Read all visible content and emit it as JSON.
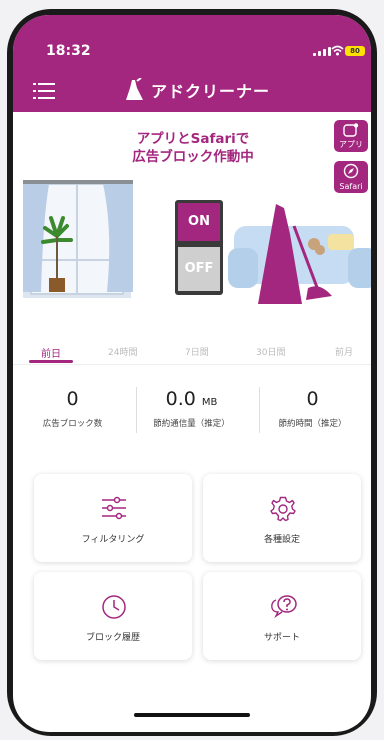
{
  "status_bar": {
    "time": "18:32",
    "battery": "80"
  },
  "navbar": {
    "app_name": "アドクリーナー"
  },
  "hero": {
    "headline_line1": "アプリとSafariで",
    "headline_line2": "広告ブロック作動中",
    "app_button_label": "アプリ",
    "safari_button_label": "Safari",
    "switch_on": "ON",
    "switch_off": "OFF"
  },
  "tabs": [
    "前日",
    "24時間",
    "7日間",
    "30日間",
    "前月"
  ],
  "active_tab": "前日",
  "stats": [
    {
      "value": "0",
      "unit": "",
      "label": "広告ブロック数"
    },
    {
      "value": "0.0",
      "unit": "MB",
      "label": "節約通信量（推定）"
    },
    {
      "value": "0",
      "unit": "",
      "label": "節約時間（推定）"
    }
  ],
  "cards": [
    {
      "label": "フィルタリング",
      "icon": "sliders-icon"
    },
    {
      "label": "各種設定",
      "icon": "gear-icon"
    },
    {
      "label": "ブロック履歴",
      "icon": "clock-icon"
    },
    {
      "label": "サポート",
      "icon": "chat-question-icon"
    }
  ],
  "colors": {
    "brand": "#a3277f",
    "battery": "#ffe100"
  }
}
